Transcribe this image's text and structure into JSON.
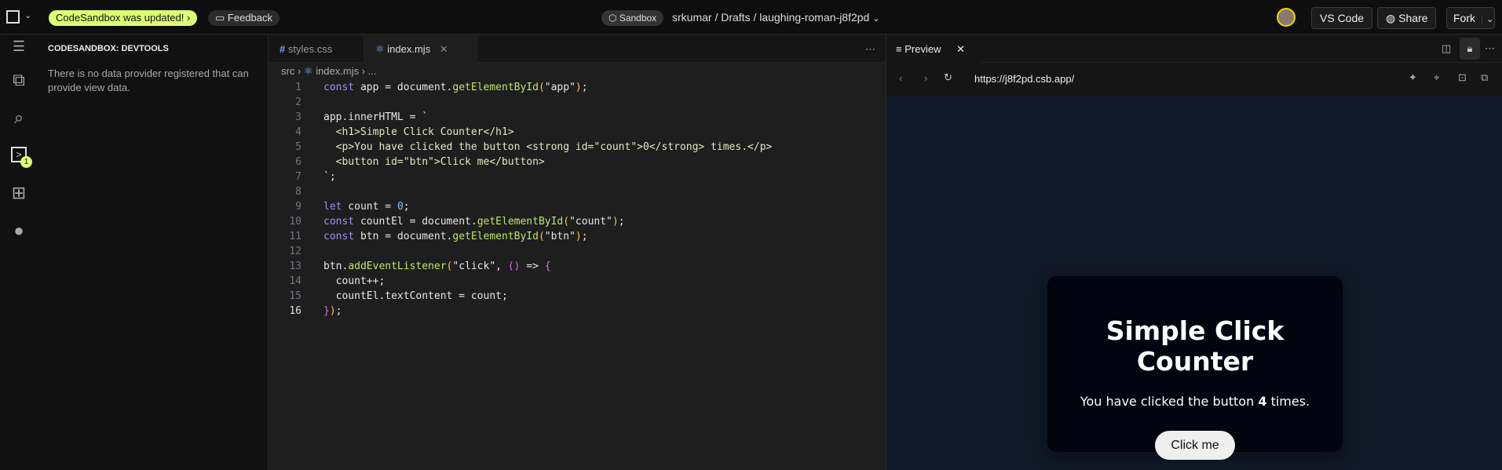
{
  "topbar": {
    "update_badge": "CodeSandbox was updated!",
    "feedback": "Feedback",
    "sandbox_badge": "Sandbox",
    "breadcrumb": [
      "srkumar",
      "Drafts",
      "laughing-roman-j8f2pd"
    ],
    "vscode": "VS Code",
    "share": "Share",
    "fork": "Fork"
  },
  "activity": {
    "badge": "1"
  },
  "sidebar": {
    "title": "CODESANDBOX: DEVTOOLS",
    "message": "There is no data provider registered that can provide view data."
  },
  "editor": {
    "tabs": [
      {
        "label": "styles.css",
        "icon": "#"
      },
      {
        "label": "index.mjs"
      }
    ],
    "breadcrumb": [
      "src",
      "index.mjs",
      "..."
    ],
    "lines": [
      "1",
      "2",
      "3",
      "4",
      "5",
      "6",
      "7",
      "8",
      "9",
      "10",
      "11",
      "12",
      "13",
      "14",
      "15",
      "16"
    ]
  },
  "preview": {
    "tab": "Preview",
    "url": "https://j8f2pd.csb.app/",
    "title": "Simple Click Counter",
    "text_before": "You have clicked the button",
    "count": "4",
    "text_after": "times.",
    "button": "Click me"
  }
}
